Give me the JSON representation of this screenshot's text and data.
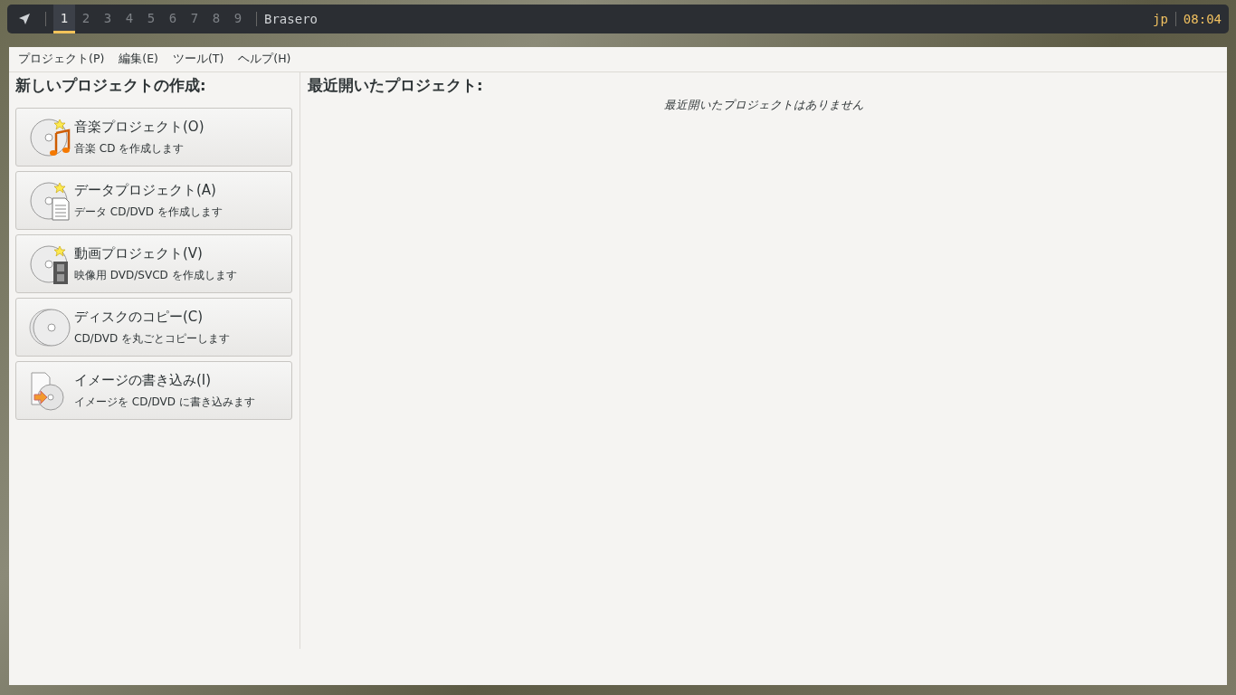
{
  "panel": {
    "workspaces": [
      {
        "label": "1",
        "selected": true
      },
      {
        "label": "2",
        "selected": false
      },
      {
        "label": "3",
        "selected": false
      },
      {
        "label": "4",
        "selected": false
      },
      {
        "label": "5",
        "selected": false
      },
      {
        "label": "6",
        "selected": false
      },
      {
        "label": "7",
        "selected": false
      },
      {
        "label": "8",
        "selected": false
      },
      {
        "label": "9",
        "selected": false
      }
    ],
    "window_title": "Brasero",
    "keyboard_layout": "jp",
    "clock": "08:04"
  },
  "menu": [
    "プロジェクト(P)",
    "編集(E)",
    "ツール(T)",
    "ヘルプ(H)"
  ],
  "new_project": {
    "heading": "新しいプロジェクトの作成:",
    "buttons": [
      {
        "kind": "audio",
        "title": "音楽プロジェクト(O)",
        "subtitle": "音楽  CD を作成します"
      },
      {
        "kind": "data",
        "title": "データプロジェクト(A)",
        "subtitle": "データ  CD/DVD を作成します"
      },
      {
        "kind": "video",
        "title": "動画プロジェクト(V)",
        "subtitle": "映像用  DVD/SVCD を作成します"
      },
      {
        "kind": "copy",
        "title": "ディスクのコピー(C)",
        "subtitle": "CD/DVD を丸ごとコピーします"
      },
      {
        "kind": "image",
        "title": "イメージの書き込み(I)",
        "subtitle": "イメージを  CD/DVD に書き込みます"
      }
    ]
  },
  "recent": {
    "heading": "最近開いたプロジェクト:",
    "empty_message": "最近開いたプロジェクトはありません"
  }
}
